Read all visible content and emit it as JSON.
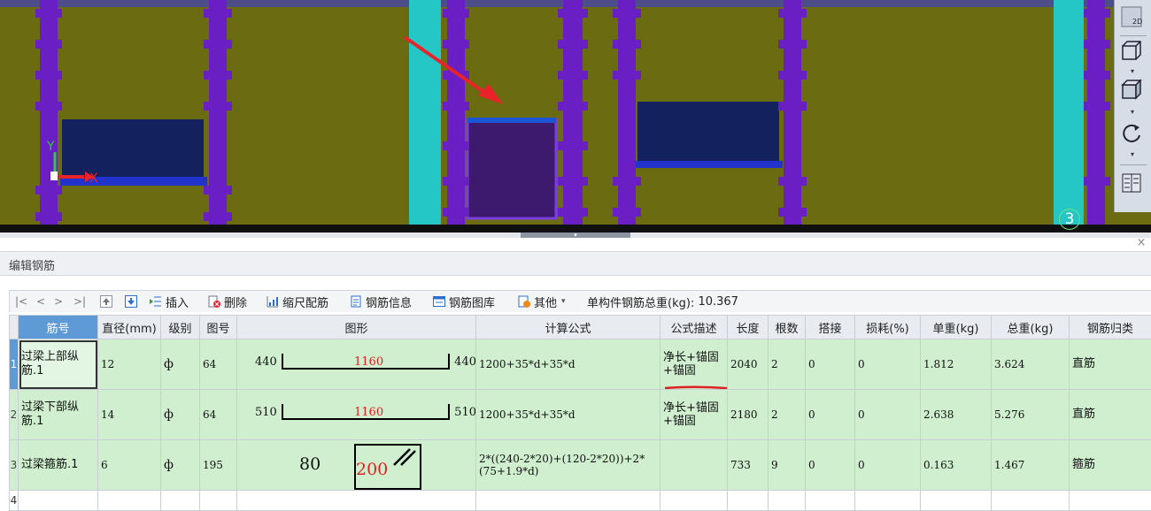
{
  "viewport": {
    "axis_y": "Y",
    "axis_x": "X",
    "grid_number": "3",
    "tools": [
      {
        "name": "2d-view-icon",
        "label": "2D"
      },
      {
        "name": "wireframe-cube-icon",
        "label": ""
      },
      {
        "name": "solid-cube-icon",
        "label": ""
      },
      {
        "name": "rotate-icon",
        "label": ""
      },
      {
        "name": "layout-icon",
        "label": ""
      }
    ],
    "colors": {
      "background": "#6b6b12",
      "column": "#6a1fc4",
      "pillar": "#25c6c6",
      "window": "#13225e",
      "beam": "#3e1a6e",
      "arrow": "#e8232a"
    }
  },
  "panel": {
    "title": "编辑钢筋",
    "close": "×"
  },
  "toolbar": {
    "nav_first": "|<",
    "nav_prev": "<",
    "nav_next": ">",
    "nav_last": ">|",
    "insert": "插入",
    "delete": "删除",
    "scale_rebar": "缩尺配筋",
    "rebar_info": "钢筋信息",
    "rebar_library": "钢筋图库",
    "other": "其他",
    "total_weight_label": "单构件钢筋总重(kg):",
    "total_weight": "10.367"
  },
  "table": {
    "columns": [
      "筋号",
      "直径(mm)",
      "级别",
      "图号",
      "图形",
      "计算公式",
      "公式描述",
      "长度",
      "根数",
      "搭接",
      "损耗(%)",
      "单重(kg)",
      "总重(kg)",
      "钢筋归类"
    ],
    "rows": [
      {
        "no": "1",
        "name": "过梁上部纵筋.1",
        "diameter": "12",
        "grade": "ф",
        "fig": "64",
        "shape": {
          "left": "440",
          "mid": "1160",
          "right": "440"
        },
        "formula": "1200+35*d+35*d",
        "desc": "净长+锚固+锚固",
        "length": "2040",
        "count": "2",
        "lap": "0",
        "loss": "0",
        "unit_w": "1.812",
        "total_w": "3.624",
        "category": "直筋"
      },
      {
        "no": "2",
        "name": "过梁下部纵筋.1",
        "diameter": "14",
        "grade": "ф",
        "fig": "64",
        "shape": {
          "left": "510",
          "mid": "1160",
          "right": "510"
        },
        "formula": "1200+35*d+35*d",
        "desc": "净长+锚固+锚固",
        "length": "2180",
        "count": "2",
        "lap": "0",
        "loss": "0",
        "unit_w": "2.638",
        "total_w": "5.276",
        "category": "直筋"
      },
      {
        "no": "3",
        "name": "过梁箍筋.1",
        "diameter": "6",
        "grade": "ф",
        "fig": "195",
        "shape": {
          "left": "80",
          "mid": "200",
          "right": ""
        },
        "formula": "2*((240-2*20)+(120-2*20))+2*(75+1.9*d)",
        "desc": "",
        "length": "733",
        "count": "9",
        "lap": "0",
        "loss": "0",
        "unit_w": "0.163",
        "total_w": "1.467",
        "category": "箍筋"
      },
      {
        "no": "4"
      }
    ]
  }
}
